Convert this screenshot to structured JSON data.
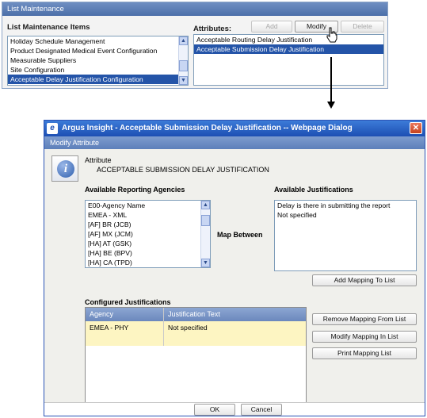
{
  "list_maintenance": {
    "title": "List Maintenance",
    "items_label": "List Maintenance Items",
    "items": [
      {
        "label": "Holiday Schedule Management",
        "selected": false
      },
      {
        "label": "Product Designated Medical Event Configuration",
        "selected": false
      },
      {
        "label": "Measurable Suppliers",
        "selected": false
      },
      {
        "label": "Site Configuration",
        "selected": false
      },
      {
        "label": "Acceptable Delay Justification Configuration",
        "selected": true
      }
    ],
    "attributes_label": "Attributes:",
    "buttons": {
      "add": "Add",
      "modify": "Modify",
      "delete": "Delete"
    },
    "attributes": [
      {
        "label": "Acceptable Routing Delay Justification",
        "selected": false
      },
      {
        "label": "Acceptable Submission Delay Justification",
        "selected": true
      }
    ]
  },
  "dialog": {
    "title": "Argus Insight - Acceptable Submission Delay Justification -- Webpage Dialog",
    "subtitle": "Modify Attribute",
    "attribute_label": "Attribute",
    "attribute_value": "ACCEPTABLE SUBMISSION DELAY JUSTIFICATION",
    "agencies_label": "Available Reporting Agencies",
    "agencies": [
      "E00-Agency Name",
      "EMEA - XML",
      "[AF] BR (JCB)",
      "[AF] MX (JCM)",
      "[HA] AT (GSK)",
      "[HA] BE (BPV)",
      "[HA] CA (TPD)"
    ],
    "map_between": "Map Between",
    "justifications_label": "Available Justifications",
    "justifications": [
      "Delay is there in submitting the report",
      "Not specified"
    ],
    "add_mapping": "Add Mapping To List",
    "configured_label": "Configured Justifications",
    "grid": {
      "columns": [
        "Agency",
        "Justification Text"
      ],
      "rows": [
        {
          "agency": "EMEA - PHY",
          "text": "Not specified"
        }
      ]
    },
    "remove_mapping": "Remove Mapping From List",
    "modify_mapping": "Modify Mapping In List",
    "print_mapping": "Print Mapping List",
    "ok": "OK",
    "cancel": "Cancel"
  },
  "colors": {
    "title_bar": "#1d4fb3",
    "panel_header": "#4c6fa9",
    "selection": "#2454a8",
    "grid_row": "#fdf5c2",
    "close_button": "#c5411e"
  }
}
